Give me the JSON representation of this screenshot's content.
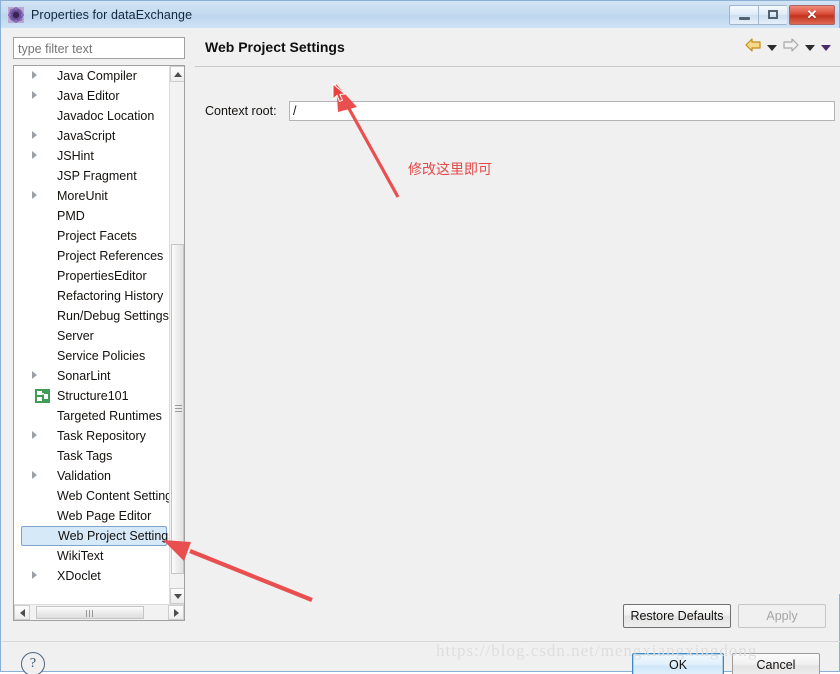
{
  "window": {
    "title": "Properties for dataExchange",
    "icon": "properties-gear-icon",
    "minimize_label": "Minimize",
    "maximize_label": "Maximize",
    "close_label": "✕",
    "ghost_title": "Properties for dataExchange"
  },
  "filter": {
    "placeholder": "type filter text",
    "value": ""
  },
  "tree": {
    "items": [
      {
        "label": "Java Compiler",
        "expandable": true,
        "icon": null,
        "selected": false
      },
      {
        "label": "Java Editor",
        "expandable": true,
        "icon": null,
        "selected": false
      },
      {
        "label": "Javadoc Location",
        "expandable": false,
        "icon": null,
        "selected": false
      },
      {
        "label": "JavaScript",
        "expandable": true,
        "icon": null,
        "selected": false
      },
      {
        "label": "JSHint",
        "expandable": true,
        "icon": null,
        "selected": false
      },
      {
        "label": "JSP Fragment",
        "expandable": false,
        "icon": null,
        "selected": false
      },
      {
        "label": "MoreUnit",
        "expandable": true,
        "icon": null,
        "selected": false
      },
      {
        "label": "PMD",
        "expandable": false,
        "icon": null,
        "selected": false
      },
      {
        "label": "Project Facets",
        "expandable": false,
        "icon": null,
        "selected": false
      },
      {
        "label": "Project References",
        "expandable": false,
        "icon": null,
        "selected": false
      },
      {
        "label": "PropertiesEditor",
        "expandable": false,
        "icon": null,
        "selected": false
      },
      {
        "label": "Refactoring History",
        "expandable": false,
        "icon": null,
        "selected": false
      },
      {
        "label": "Run/Debug Settings",
        "expandable": false,
        "icon": null,
        "selected": false
      },
      {
        "label": "Server",
        "expandable": false,
        "icon": null,
        "selected": false
      },
      {
        "label": "Service Policies",
        "expandable": false,
        "icon": null,
        "selected": false
      },
      {
        "label": "SonarLint",
        "expandable": true,
        "icon": null,
        "selected": false
      },
      {
        "label": "Structure101",
        "expandable": false,
        "icon": "structure101-icon",
        "selected": false
      },
      {
        "label": "Targeted Runtimes",
        "expandable": false,
        "icon": null,
        "selected": false
      },
      {
        "label": "Task Repository",
        "expandable": true,
        "icon": null,
        "selected": false
      },
      {
        "label": "Task Tags",
        "expandable": false,
        "icon": null,
        "selected": false
      },
      {
        "label": "Validation",
        "expandable": true,
        "icon": null,
        "selected": false
      },
      {
        "label": "Web Content Settings",
        "expandable": false,
        "icon": null,
        "selected": false
      },
      {
        "label": "Web Page Editor",
        "expandable": false,
        "icon": null,
        "selected": false
      },
      {
        "label": "Web Project Settings",
        "expandable": false,
        "icon": null,
        "selected": true
      },
      {
        "label": "WikiText",
        "expandable": false,
        "icon": null,
        "selected": false
      },
      {
        "label": "XDoclet",
        "expandable": true,
        "icon": null,
        "selected": false
      }
    ]
  },
  "page": {
    "title": "Web Project Settings",
    "context_root_label": "Context root:",
    "context_root_value": "/",
    "nav": {
      "back_icon": "back-arrow-icon",
      "back_menu_icon": "chevron-down-icon",
      "forward_icon": "forward-arrow-icon",
      "forward_menu_icon": "chevron-down-icon",
      "view_menu_icon": "chevron-down-icon"
    }
  },
  "buttons": {
    "restore_defaults": "Restore Defaults",
    "apply": "Apply",
    "apply_enabled": false,
    "ok": "OK",
    "cancel": "Cancel",
    "help": "?"
  },
  "annotations": {
    "note": "修改这里即可",
    "note_color": "#e24a4a",
    "arrow_color": "#ea4f4f",
    "watermark": "https://blog.csdn.net/mengxiangxingdong"
  },
  "colors": {
    "titlebar_start": "#d3e4f4",
    "titlebar_end": "#cfe3f5",
    "dialog_bg": "#f0f0f0",
    "selection_bg": "#d6e9f8",
    "selection_border": "#7da2ce",
    "close_button": "#d94b35",
    "ok_border": "#3c8bc6"
  }
}
